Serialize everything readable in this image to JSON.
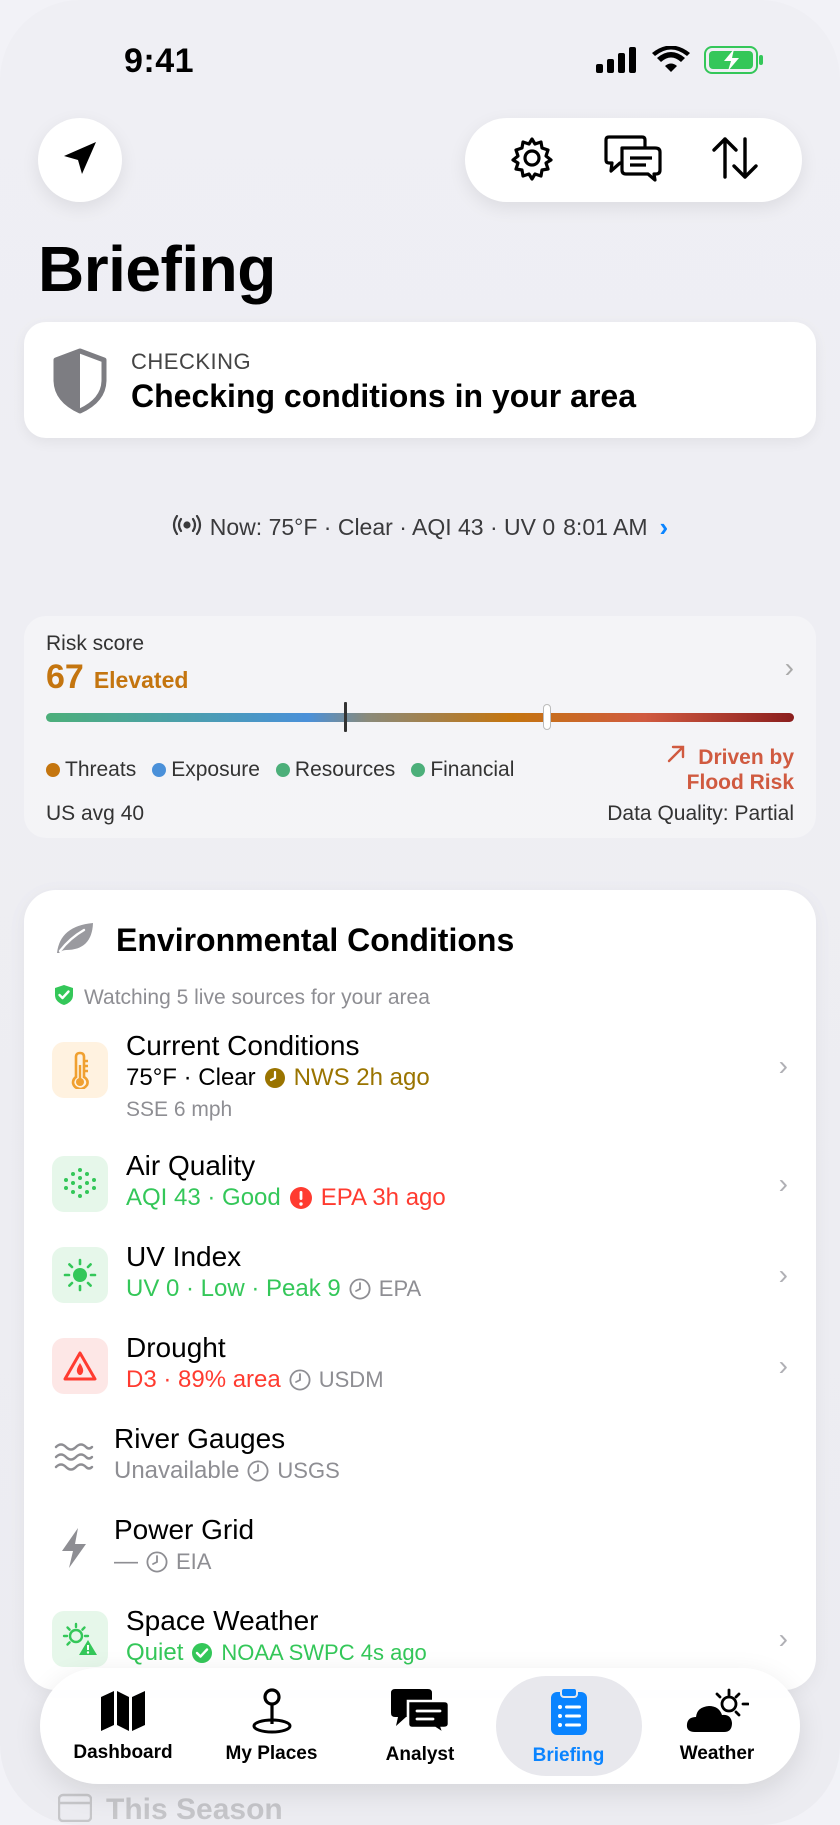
{
  "status_bar": {
    "time": "9:41"
  },
  "header": {
    "title": "Briefing",
    "location_icon": "location-arrow-icon",
    "toolbar_icons": [
      "gear-icon",
      "chat-bubbles-icon",
      "sort-arrows-icon"
    ]
  },
  "checking": {
    "kicker": "CHECKING",
    "title": "Checking conditions in your area"
  },
  "now": {
    "text": "Now: 75°F · Clear · AQI 43 · UV 0",
    "time": "8:01 AM"
  },
  "risk": {
    "label": "Risk score",
    "score": "67",
    "level": "Elevated",
    "score_value": 67,
    "marker_value": 40,
    "legend": [
      {
        "label": "Threats",
        "color": "#c4750f"
      },
      {
        "label": "Exposure",
        "color": "#4a90d9"
      },
      {
        "label": "Resources",
        "color": "#4caf7a"
      },
      {
        "label": "Financial",
        "color": "#4caf7a"
      }
    ],
    "driver_line1": "Driven by",
    "driver_line2": "Flood Risk",
    "us_avg": "US avg 40",
    "data_quality": "Data Quality: Partial",
    "colors": {
      "accent": "#c4750f",
      "driver": "#d05a40"
    }
  },
  "env": {
    "title": "Environmental Conditions",
    "watching": "Watching 5 live sources for your area",
    "rows": [
      {
        "title": "Current Conditions",
        "value": "75°F · Clear",
        "source": "NWS 2h ago",
        "extra": "SSE 6 mph",
        "value_color": "#000000",
        "source_color": "#9a7400",
        "icon": "thermometer-icon"
      },
      {
        "title": "Air Quality",
        "value": "AQI 43 · Good",
        "source": "EPA 3h ago",
        "value_color": "#34c759",
        "source_color": "#ff3b30",
        "icon": "air-particles-icon"
      },
      {
        "title": "UV Index",
        "value": "UV 0 · Low · Peak 9",
        "source": "EPA",
        "value_color": "#34c759",
        "source_color": "#8e8e93",
        "icon": "sun-icon"
      },
      {
        "title": "Drought",
        "value": "D3 · 89% area",
        "source": "USDM",
        "value_color": "#ff3b30",
        "source_color": "#8e8e93",
        "icon": "drought-warning-icon"
      },
      {
        "title": "River Gauges",
        "value": "Unavailable",
        "source": "USGS",
        "value_color": "#8e8e93",
        "source_color": "#8e8e93",
        "icon": "water-waves-icon"
      },
      {
        "title": "Power Grid",
        "value": "—",
        "source": "EIA",
        "value_color": "#8e8e93",
        "source_color": "#8e8e93",
        "icon": "lightning-bolt-icon"
      },
      {
        "title": "Space Weather",
        "value": "Quiet",
        "source": "NOAA SWPC 4s ago",
        "value_color": "#34c759",
        "source_color": "#34c759",
        "icon": "space-weather-icon"
      }
    ]
  },
  "tabs": [
    {
      "label": "Dashboard",
      "icon": "map-icon"
    },
    {
      "label": "My Places",
      "icon": "pin-icon"
    },
    {
      "label": "Analyst",
      "icon": "chat-bubbles-icon"
    },
    {
      "label": "Briefing",
      "icon": "clipboard-icon",
      "active": true
    },
    {
      "label": "Weather",
      "icon": "partly-cloudy-icon"
    }
  ],
  "peek": {
    "label": "This Season"
  },
  "colors": {
    "accent": "#0a84ff"
  }
}
